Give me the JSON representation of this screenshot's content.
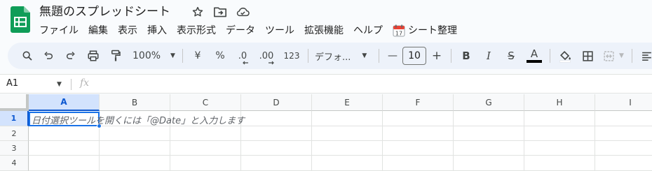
{
  "doc": {
    "title": "無題のスプレッドシート"
  },
  "menu": [
    {
      "label": "ファイル"
    },
    {
      "label": "編集"
    },
    {
      "label": "表示"
    },
    {
      "label": "挿入"
    },
    {
      "label": "表示形式"
    },
    {
      "label": "データ"
    },
    {
      "label": "ツール"
    },
    {
      "label": "拡張機能"
    },
    {
      "label": "ヘルプ"
    },
    {
      "label": "シート整理",
      "icon": "calendar-icon"
    }
  ],
  "toolbar": {
    "zoom": "100%",
    "currency": "¥",
    "percent": "%",
    "decimal_decrease": ".0",
    "decimal_increase": ".00",
    "more_formats": "123",
    "font": "デフォ...",
    "font_size": "10",
    "minus": "—",
    "plus": "+",
    "bold": "B",
    "italic": "I",
    "strike": "S",
    "text_color": "A"
  },
  "formula": {
    "name_box": "A1",
    "fx": "fx"
  },
  "grid": {
    "columns": [
      "A",
      "B",
      "C",
      "D",
      "E",
      "F",
      "G",
      "H",
      "I"
    ],
    "rows": [
      "1",
      "2",
      "3",
      "4"
    ],
    "selected_column": "A",
    "selected_row": "1",
    "hint": "日付選択ツールを開くには「@Date」と入力します"
  },
  "colors": {
    "accent": "#0b57d0",
    "toolbar_bg": "#edf2fa",
    "selection_bg": "#d3e3fd",
    "logo_green": "#0f9d58"
  }
}
